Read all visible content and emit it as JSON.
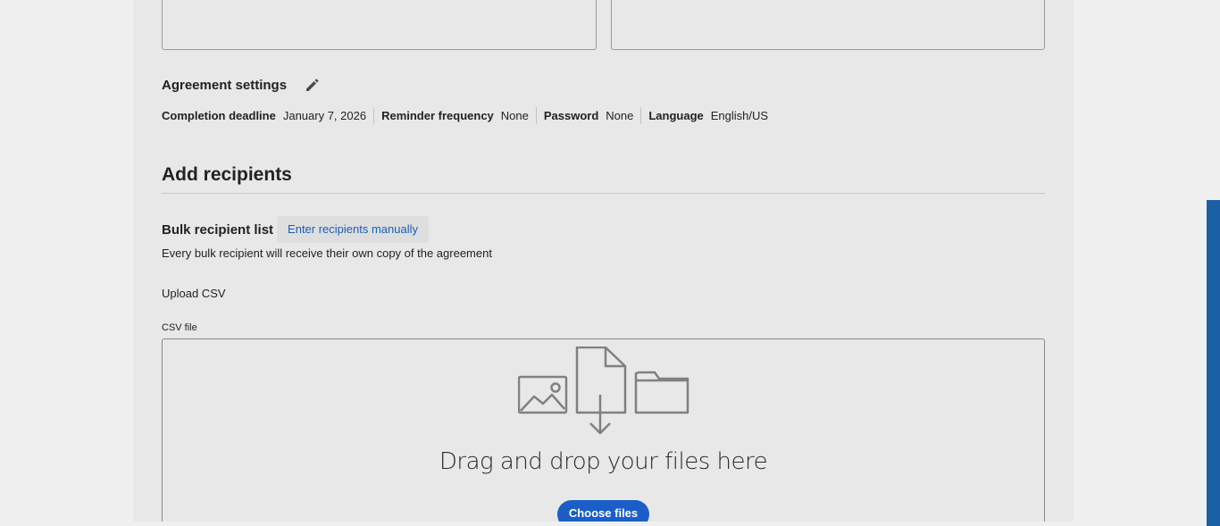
{
  "agreement_settings": {
    "title": "Agreement settings",
    "edit_icon": "pencil-icon",
    "items": [
      {
        "label": "Completion deadline",
        "value": "January 7, 2026"
      },
      {
        "label": "Reminder frequency",
        "value": "None"
      },
      {
        "label": "Password",
        "value": "None"
      },
      {
        "label": "Language",
        "value": "English/US"
      }
    ]
  },
  "recipients": {
    "title": "Add recipients",
    "tabs": {
      "active": "Bulk recipient list",
      "inactive": "Enter recipients manually"
    },
    "helper_text": "Every bulk recipient will receive their own copy of the agreement",
    "upload_label": "Upload CSV",
    "csv_field_label": "CSV file",
    "dropzone_text": "Drag and drop your files here",
    "choose_button": "Choose files",
    "dropzone_icons": [
      "image-icon",
      "file-download-icon",
      "folder-icon"
    ]
  },
  "colors": {
    "accent": "#1b5ec8",
    "link": "#1a5fb4",
    "panel_bg": "#e8e8e8",
    "page_bg": "#f0f0f0",
    "side_strip": "#1b5fa5"
  }
}
